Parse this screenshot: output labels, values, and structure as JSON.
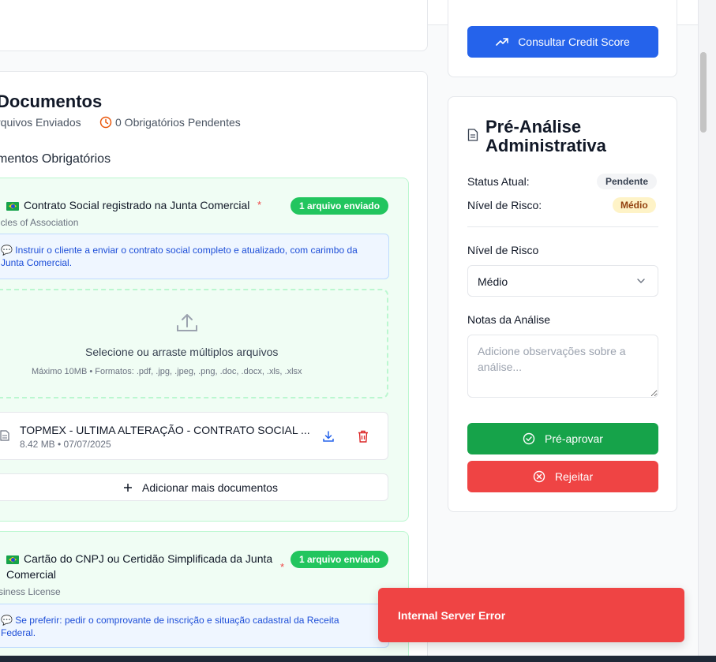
{
  "credit_button": {
    "label": "Consultar Credit Score"
  },
  "documents": {
    "title": "Documentos",
    "sent_summary": "rquivos Enviados",
    "pending_summary": "0 Obrigatórios Pendentes",
    "section_title": "mentos Obrigatórios",
    "items": [
      {
        "title": "Contrato Social registrado na Junta Comercial",
        "required_mark": "*",
        "badge": "1 arquivo enviado",
        "subtitle": "icles of Association",
        "note_line1": "💬 Instruir o cliente a enviar o contrato social completo e atualizado, com carimbo da",
        "note_line2": "Junta Comercial.",
        "upload_text": "Selecione ou arraste múltiplos arquivos",
        "upload_hint": "Máximo 10MB • Formatos: .pdf, .jpg, .jpeg, .png, .doc, .docx, .xls, .xlsx",
        "file_name": "TOPMEX - ULTIMA ALTERAÇÃO - CONTRATO SOCIAL ...",
        "file_meta": "8.42 MB • 07/07/2025",
        "add_more": "Adicionar mais documentos"
      },
      {
        "title_line1": "Cartão do CNPJ ou Certidão Simplificada da Junta",
        "title_line2": "Comercial",
        "required_mark": "*",
        "badge": "1 arquivo enviado",
        "subtitle": "siness License",
        "note_line1": "💬 Se preferir: pedir o comprovante de inscrição e situação cadastral da Receita",
        "note_line2": "Federal."
      }
    ]
  },
  "pre_analysis": {
    "title": "Pré-Análise Administrativa",
    "status_label": "Status Atual:",
    "status_value": "Pendente",
    "risk_label": "Nível de Risco:",
    "risk_value": "Médio",
    "risk_select_label": "Nível de Risco",
    "risk_select_value": "Médio",
    "notes_label": "Notas da Análise",
    "notes_placeholder": "Adicione observações sobre a análise...",
    "approve_label": "Pré-aprovar",
    "reject_label": "Rejeitar"
  },
  "toast": {
    "message": "Internal Server Error"
  },
  "colors": {
    "primary_blue": "#2563eb",
    "approve_green": "#16a34a",
    "reject_red": "#ef4444",
    "badge_green": "#22c55e",
    "warning_yellow": "#fef3c7"
  },
  "icons": [
    "trending-up-icon",
    "clock-icon",
    "upload-icon",
    "file-icon",
    "download-icon",
    "trash-icon",
    "plus-icon",
    "document-icon",
    "chevron-down-icon",
    "check-circle-icon",
    "x-circle-icon",
    "bell-icon"
  ]
}
